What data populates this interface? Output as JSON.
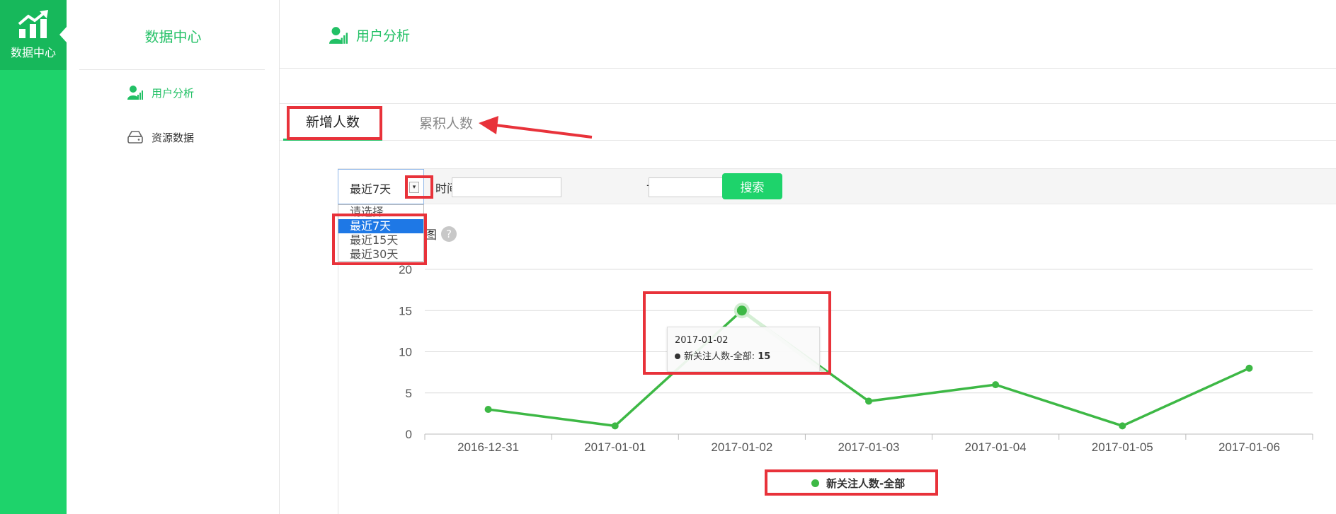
{
  "rail": {
    "label": "数据中心",
    "icon": "trend-up-chart-icon"
  },
  "sidebar": {
    "title": "数据中心",
    "items": [
      {
        "label": "用户分析",
        "icon": "user-chart-icon",
        "active": true
      },
      {
        "label": "资源数据",
        "icon": "storage-icon",
        "active": false
      }
    ]
  },
  "page": {
    "title": "用户分析",
    "icon": "user-chart-icon"
  },
  "tabs": [
    {
      "label": "新增人数",
      "active": true
    },
    {
      "label": "累积人数",
      "active": false
    }
  ],
  "filter": {
    "select_value": "最近7天",
    "arrow": "▾",
    "options": [
      "请选择",
      "最近7天",
      "最近15天",
      "最近30天"
    ],
    "selected_option": "最近7天",
    "range_label": "时间段:",
    "start_value": "",
    "end_value": "",
    "dash": "-",
    "search_label": "搜索"
  },
  "chart_section": {
    "title_suffix": "图",
    "help": "?"
  },
  "tooltip": {
    "date": "2017-01-02",
    "series": "新关注人数-全部:",
    "value": "15"
  },
  "legend": {
    "label": "新关注人数-全部"
  },
  "colors": {
    "accent": "#1ed36b",
    "line": "#3db845",
    "annotation": "#e8323a",
    "selected": "#1e78e6"
  },
  "chart_data": {
    "type": "line",
    "x": [
      "2016-12-31",
      "2017-01-01",
      "2017-01-02",
      "2017-01-03",
      "2017-01-04",
      "2017-01-05",
      "2017-01-06"
    ],
    "series": [
      {
        "name": "新关注人数-全部",
        "values": [
          3,
          1,
          15,
          4,
          6,
          1,
          8
        ]
      }
    ],
    "ylim": [
      0,
      20
    ],
    "yticks": [
      "0",
      "5",
      "10",
      "15",
      "20"
    ],
    "grid": true,
    "legend": "bottom",
    "highlighted_index": 2
  }
}
